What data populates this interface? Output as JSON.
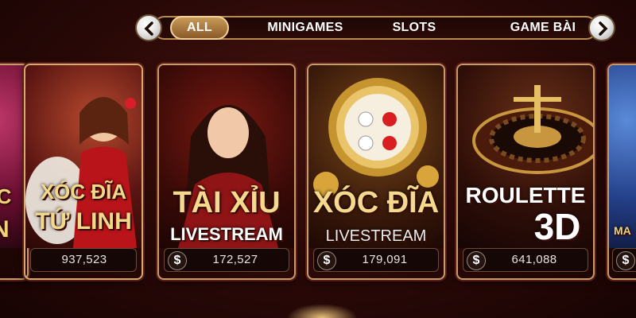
{
  "tabs": {
    "items": [
      {
        "label": "ALL",
        "active": true
      },
      {
        "label": "MINIGAMES",
        "active": false
      },
      {
        "label": "SLOTS",
        "active": false
      },
      {
        "label": "GAME BÀI",
        "active": false
      }
    ],
    "prev_icon": "chevron-left-icon",
    "next_icon": "chevron-right-icon"
  },
  "cards": [
    {
      "title_line1": "ỰC",
      "title_line2": "N",
      "count": ""
    },
    {
      "title_line1": "XÓC ĐĨA",
      "title_line2": "TỨ LINH",
      "count": "937,523"
    },
    {
      "title_line1": "TÀI XỈU",
      "title_line2": "LIVESTREAM",
      "count": "172,527"
    },
    {
      "title_line1": "XÓC ĐĨA",
      "title_line2": "LIVESTREAM",
      "count": "179,091"
    },
    {
      "title_line1": "ROULETTE",
      "title_line2": "3D",
      "count": "641,088"
    },
    {
      "title_line1": "MA",
      "title_line2": "",
      "count": ""
    }
  ],
  "currency_symbol": "$",
  "colors": {
    "accent_gold": "#c89a58",
    "background": "#2a0907"
  }
}
